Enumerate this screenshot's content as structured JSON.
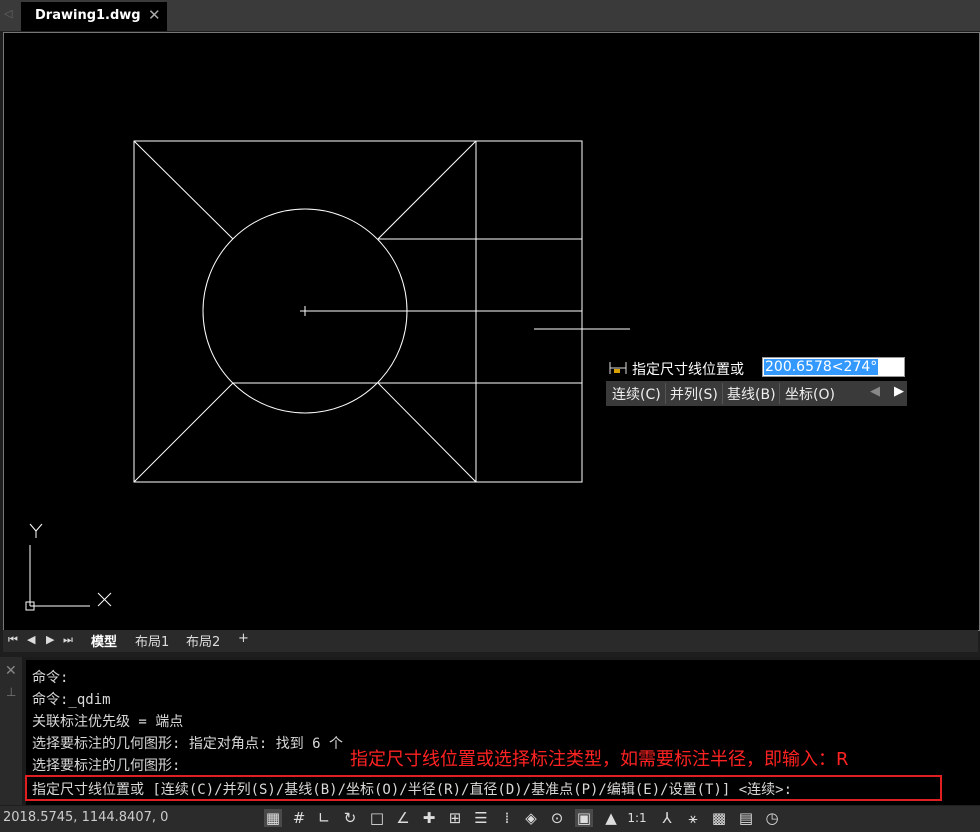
{
  "tabs": {
    "left_arrow": "◁",
    "document": "Drawing1.dwg",
    "close": "✕"
  },
  "dynamic_input": {
    "prompt": "指定尺寸线位置或",
    "value": "200.6578<274°",
    "options": [
      "连续(C)",
      "并列(S)",
      "基线(B)",
      "坐标(O)"
    ],
    "prev": "◀",
    "next": "▶"
  },
  "ucs": {
    "y_label": "Y",
    "x_label": "X"
  },
  "layout_tabs": {
    "nav": [
      "⏮",
      "◀",
      "▶",
      "⏭"
    ],
    "items": [
      "模型",
      "布局1",
      "布局2",
      "+"
    ]
  },
  "command": {
    "close": "✕",
    "pin": "⊥",
    "lines": [
      "命令:",
      "命令:_qdim",
      "关联标注优先级 = 端点",
      "选择要标注的几何图形: 指定对角点: 找到 6 个",
      "选择要标注的几何图形:",
      "指定尺寸线位置或 [连续(C)/并列(S)/基线(B)/坐标(O)/半径(R)/直径(D)/基准点(P)/编辑(E)/设置(T)] <连续>:"
    ],
    "annotation": "指定尺寸线位置或选择标注类型，如需要标注半径，即输入：R",
    "highlight_color": "#e02020"
  },
  "status": {
    "coordinates": "2018.5745, 1144.8407, 0",
    "scale": "1:1",
    "icons": [
      "grid-icon",
      "snap-icon",
      "ortho-icon",
      "polar-icon",
      "osnap-icon",
      "otrack-icon",
      "ducs-icon",
      "dyn-icon",
      "lineweight-icon",
      "transparency-icon",
      "selection-cycling-icon",
      "3dosnap-icon",
      "annotation-monitor-icon",
      "workspace-icon",
      "annotation-scale-icon",
      "annotation-visibility-icon",
      "auto-scale-icon",
      "isolate-icon",
      "properties-icon",
      "hardware-accel-icon"
    ]
  }
}
